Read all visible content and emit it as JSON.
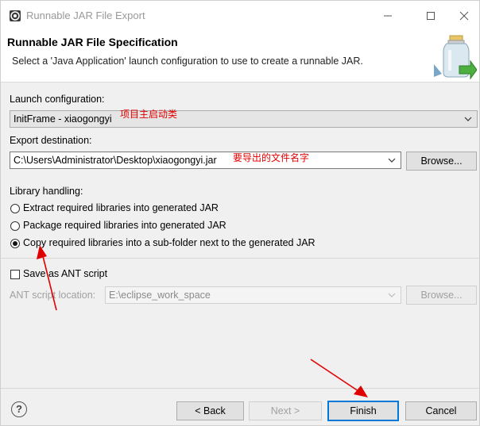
{
  "window": {
    "title": "Runnable JAR File Export"
  },
  "header": {
    "title": "Runnable JAR File Specification",
    "description": "Select a 'Java Application' launch configuration to use to create a runnable JAR."
  },
  "launch": {
    "label": "Launch configuration:",
    "value": "InitFrame - xiaogongyi",
    "annotation": "项目主启动类"
  },
  "export": {
    "label": "Export destination:",
    "value": "C:\\Users\\Administrator\\Desktop\\xiaogongyi.jar",
    "annotation": "要导出的文件名字",
    "browse_label": "Browse..."
  },
  "library": {
    "label": "Library handling:",
    "options": [
      {
        "label": "Extract required libraries into generated JAR",
        "selected": false
      },
      {
        "label": "Package required libraries into generated JAR",
        "selected": false
      },
      {
        "label": "Copy required libraries into a sub-folder next to the generated JAR",
        "selected": true
      }
    ]
  },
  "ant": {
    "save_label": "Save as ANT script",
    "checked": false,
    "location_label": "ANT script location:",
    "location_value": "E:\\eclipse_work_space",
    "browse_label": "Browse..."
  },
  "footer": {
    "help_glyph": "?",
    "back_label": "< Back",
    "next_label": "Next >",
    "finish_label": "Finish",
    "cancel_label": "Cancel"
  },
  "colors": {
    "annotation": "#e00000",
    "focus_border": "#0078d7"
  },
  "icons": [
    "eclipse-app-icon",
    "minimize-icon",
    "maximize-icon",
    "close-icon",
    "jar-icon",
    "chevron-down-icon",
    "help-icon",
    "red-arrow"
  ]
}
